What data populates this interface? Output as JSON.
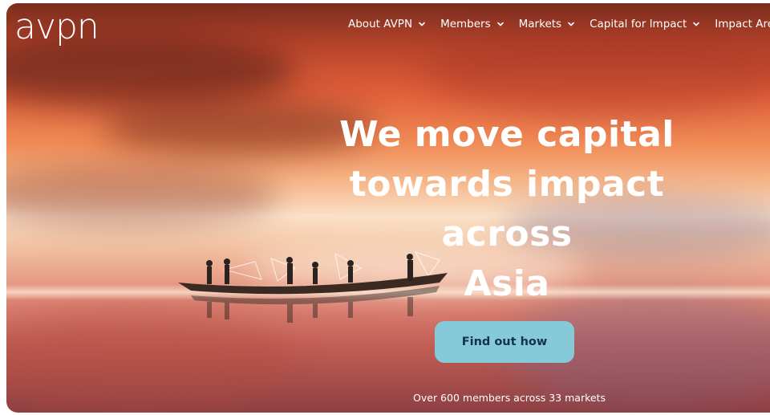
{
  "brand": {
    "logo_text": "avpn"
  },
  "nav": {
    "items": [
      {
        "label": "About AVPN",
        "icon": "chevron-down-icon"
      },
      {
        "label": "Members",
        "icon": "chevron-down-icon"
      },
      {
        "label": "Markets",
        "icon": "chevron-down-icon"
      },
      {
        "label": "Capital for Impact",
        "icon": "chevron-down-icon"
      },
      {
        "label": "Impact Areas"
      }
    ]
  },
  "hero": {
    "title_line1": "We move capital",
    "title_line2": "towards impact across",
    "title_line3": "Asia",
    "cta_label": "Find out how",
    "stats_text": "Over 600 members across 33 markets"
  },
  "colors": {
    "cta_background": "#86c9d8",
    "cta_text": "#12334a",
    "text_light": "#ffffff"
  }
}
